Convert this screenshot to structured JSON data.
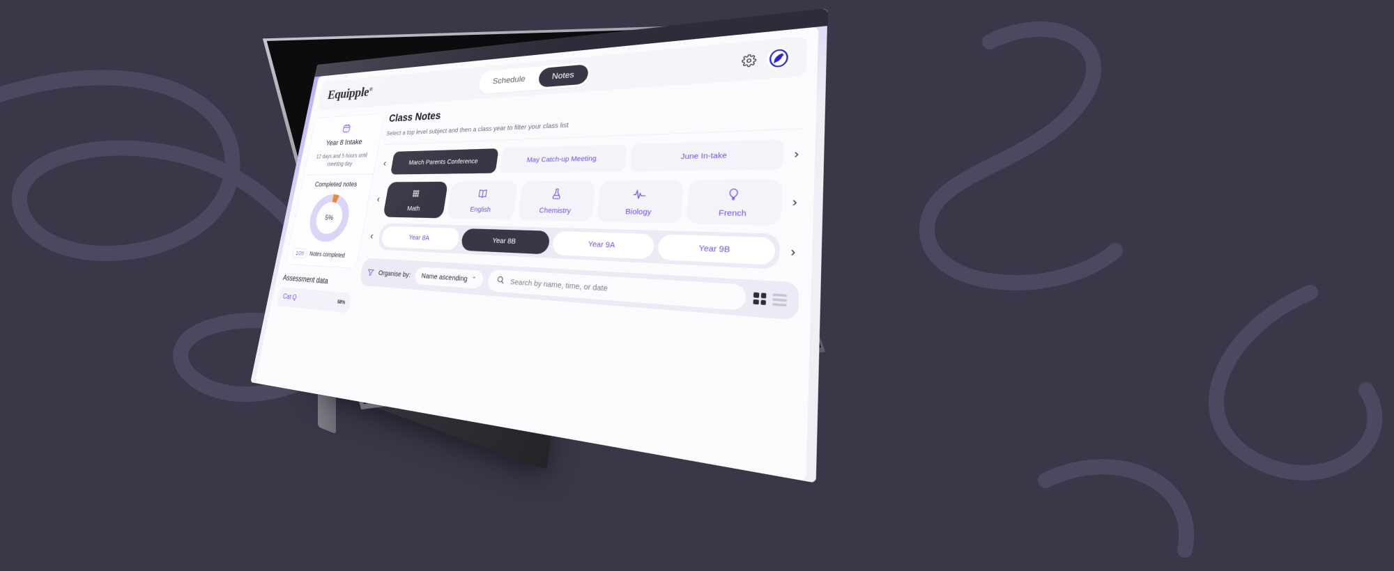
{
  "header": {
    "logo": "Equipple",
    "logo_mark": "®",
    "tabs": [
      {
        "label": "Schedule",
        "active": false
      },
      {
        "label": "Notes",
        "active": true
      }
    ],
    "settings_icon": "gear-icon",
    "avatar_icon": "user-avatar-leaf"
  },
  "sidebar": {
    "calendar_icon": "calendar-icon",
    "intake_title": "Year 8 Intake",
    "countdown": "12 days and 5 hours until meeting day",
    "completed_heading": "Completed notes",
    "donut_percent": "5%",
    "donut_value": 5,
    "notes_fraction": "1/20",
    "notes_label": "Notes completed",
    "assessment_heading": "Assessment data",
    "assessment_rows": [
      {
        "name": "Cat Q",
        "value": "58%"
      }
    ]
  },
  "main": {
    "title": "Class Notes",
    "subtitle": "Select a top level subject and then a class year to filter your class list",
    "prev_arrow": "‹",
    "next_arrow": "›",
    "events": [
      {
        "label": "March Parents Conference",
        "active": true
      },
      {
        "label": "May Catch-up Meeting",
        "active": false
      },
      {
        "label": "June In-take",
        "active": false
      }
    ],
    "subjects": [
      {
        "label": "Math",
        "icon": "abacus-icon",
        "active": true
      },
      {
        "label": "English",
        "icon": "book-icon",
        "active": false
      },
      {
        "label": "Chemistry",
        "icon": "flask-icon",
        "active": false
      },
      {
        "label": "Biology",
        "icon": "pulse-icon",
        "active": false
      },
      {
        "label": "French",
        "icon": "balloon-icon",
        "active": false
      }
    ],
    "years": [
      {
        "label": "Year 8A",
        "active": false
      },
      {
        "label": "Year 8B",
        "active": true
      },
      {
        "label": "Year 9A",
        "active": false
      },
      {
        "label": "Year 9B",
        "active": false
      }
    ]
  },
  "toolbar": {
    "filter_icon": "funnel-icon",
    "organise_label": "Organise by:",
    "sort_value": "Name ascending",
    "sort_caret": "⌃",
    "search_icon": "search-icon",
    "search_value": "",
    "search_placeholder": "Search by name, time, or date",
    "grid_view_icon": "grid-view-icon",
    "list_view_icon": "list-view-icon"
  },
  "colors": {
    "accent": "#6b55e8",
    "dark": "#3a3645",
    "donut_track": "#d9d3f7",
    "donut_fill": "#e8842c",
    "page_bg": "#3b3749"
  }
}
